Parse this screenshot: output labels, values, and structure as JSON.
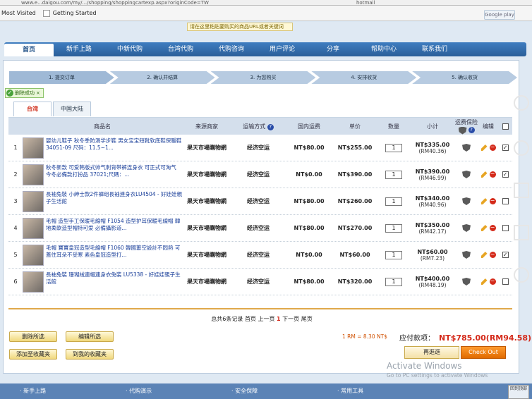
{
  "browser": {
    "url": "www.e...daigou.com/my/.../shopping/shoppingcartexp.aspx?originCode=TW",
    "search_text": "hotmail",
    "bookmarks": [
      {
        "label": "Most Visited"
      },
      {
        "label": "Getting Started"
      }
    ],
    "google_play": "Google play"
  },
  "tooltip": "请在这里粘贴要购买的商品URL或者关键词",
  "nav": [
    "首页",
    "新手上路",
    "中新代购",
    "台湾代购",
    "代购咨询",
    "用户评论",
    "分享",
    "帮助中心",
    "联系我们"
  ],
  "steps": [
    "1. 提交订单",
    "2. 确认并结算",
    "3. 为您购买",
    "4. 安排收货",
    "5. 确认收货"
  ],
  "success_msg": "删除成功",
  "tabs": [
    "台湾",
    "中国大陆"
  ],
  "table": {
    "headers": {
      "name": "商品名",
      "shop": "来源商家",
      "ship": "运输方式",
      "domestic": "国内运费",
      "price": "单价",
      "qty": "数量",
      "subtotal": "小计",
      "insurance": "运费保险",
      "edit": "编辑"
    },
    "rows": [
      {
        "n": "1",
        "desc": "婴幼儿鞋子 秋冬季防滑学步鞋 男女宝宝短靴软底鞋保暖鞋34051-09 尺码：11.5~1...",
        "shop": "果天市場購物網",
        "ship": "经济空运",
        "domestic": "NT$80.00",
        "price": "NT$255.00",
        "qty": "1",
        "subtotal": "NT$335.00",
        "rm": "(RM40.36)",
        "checked": true
      },
      {
        "n": "2",
        "desc": "秋冬新款 可爱韩版式帅气刺背带裤连身衣 可正式可淘气 今冬必備款打扮品 37021;尺碼：...",
        "shop": "果天市場購物網",
        "ship": "经济空运",
        "domestic": "NT$0.00",
        "price": "NT$390.00",
        "qty": "1",
        "subtotal": "NT$390.00",
        "rm": "(RM46.99)",
        "checked": true
      },
      {
        "n": "3",
        "desc": "長袖兔裝 小紳士款2件褲组長袖連身衣LU4504 - 好娃娃親子生活館",
        "shop": "果天市場購物網",
        "ship": "经济空运",
        "domestic": "NT$80.00",
        "price": "NT$260.00",
        "qty": "1",
        "subtotal": "NT$340.00",
        "rm": "(RM40.96)",
        "checked": false
      },
      {
        "n": "4",
        "desc": "毛帽 造型手工保暖毛線帽 F1054 造型护耳保暖毛線帽 韓地柔軟造型帽特可爱 必備攝影道...",
        "shop": "果天市場購物網",
        "ship": "经济空运",
        "domestic": "NT$80.00",
        "price": "NT$270.00",
        "qty": "1",
        "subtotal": "NT$350.00",
        "rm": "(RM42.17)",
        "checked": false
      },
      {
        "n": "5",
        "desc": "毛帽 寶寶皇冠造型毛線帽 F1060 韓國簍空設計不悶熱 可蓋住耳朵不受寒 素色皇冠造型打...",
        "shop": "果天市場購物網",
        "ship": "经济空运",
        "domestic": "NT$0.00",
        "price": "NT$60.00",
        "qty": "1",
        "subtotal": "NT$60.00",
        "rm": "(RM7.23)",
        "checked": true
      },
      {
        "n": "6",
        "desc": "長袖兔裝 珊瑚絨連帽連身衣兔裝 LU5338 - 好娃娃親子生活館",
        "shop": "果天市場購物網",
        "ship": "经济空运",
        "domestic": "NT$80.00",
        "price": "NT$320.00",
        "qty": "1",
        "subtotal": "NT$400.00",
        "rm": "(RM48.19)",
        "checked": false
      }
    ]
  },
  "pager": {
    "prefix": "总共6条记录",
    "first": "首页",
    "prev": "上一页",
    "current": "1",
    "next": "下一页",
    "last": "尾页"
  },
  "buttons": {
    "delete_selected": "删除所选",
    "edit_selected": "编辑所选",
    "add_favorites": "添加至收藏夹",
    "to_favorites": "到我的收藏夹",
    "back": "再逛逛",
    "checkout": "Check Out"
  },
  "rate": "1 RM = 8.30 NT$",
  "total_label": "应付款项：",
  "total_amount": "NT$785.00(RM94.58)",
  "footer": [
    "· 新手上路",
    "· 代购演示",
    "· 安全保障",
    "· 常用工具"
  ],
  "top_btn": "回到顶部",
  "watermark": {
    "title": "Activate Windows",
    "sub": "Go to PC settings to activate Windows"
  }
}
